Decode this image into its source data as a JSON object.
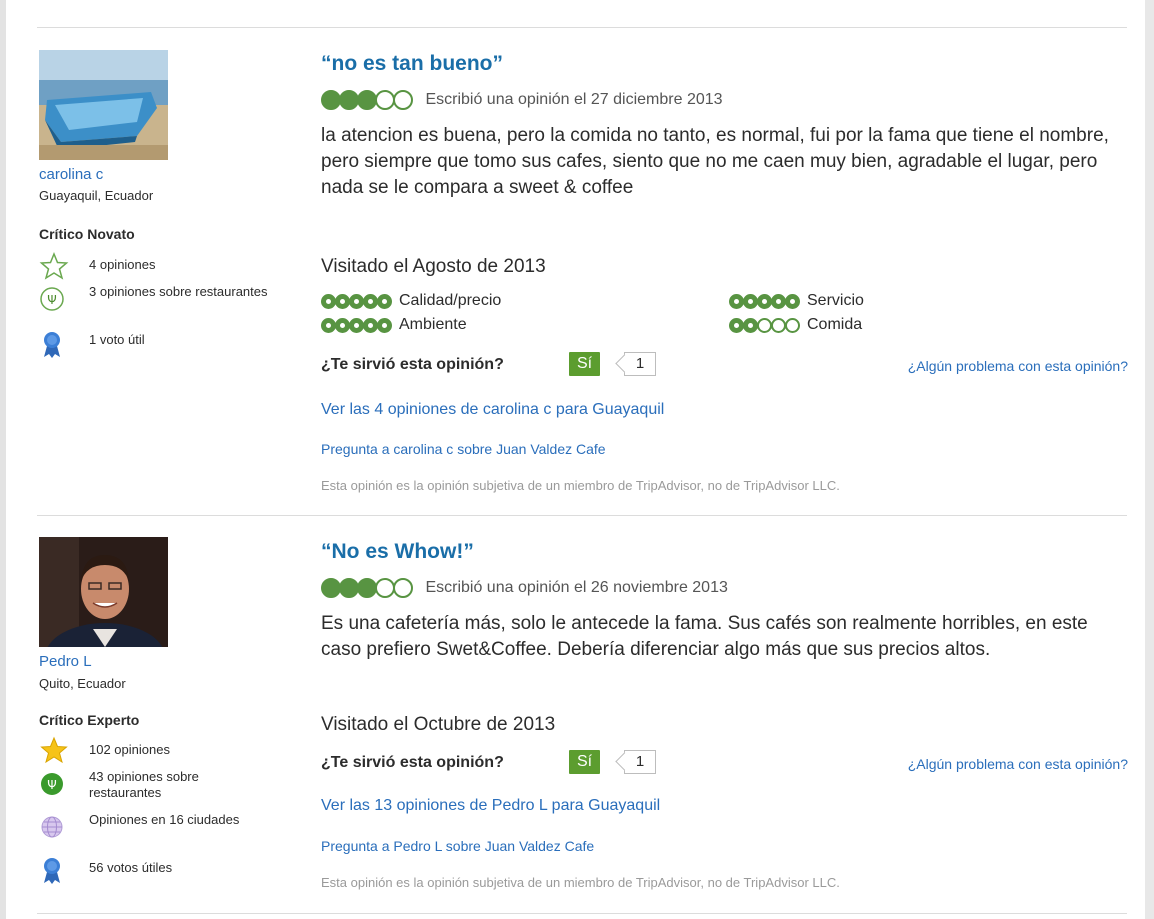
{
  "colors": {
    "link": "#2a6ebb",
    "title": "#1a6ea8",
    "bubble": "#589442",
    "helpful_button": "#5c9d2f",
    "disclaimer": "#9a9a9a"
  },
  "reviews": [
    {
      "user": {
        "name": "carolina c",
        "location": "Guayaquil, Ecuador",
        "level": "Crítico Novato"
      },
      "badges": [
        {
          "icon": "star-outline-icon",
          "text": "4 opiniones"
        },
        {
          "icon": "restaurant-fork-icon",
          "text": "3 opiniones sobre restaurantes"
        },
        {
          "icon": "ribbon-icon",
          "text": "1 voto útil"
        }
      ],
      "title": "“no es tan bueno”",
      "rating": 3,
      "date": "Escribió una opinión el 27 diciembre 2013",
      "body": "la atencion es buena, pero la comida no tanto, es normal, fui por la fama que tiene el nombre, pero siempre que tomo sus cafes, siento que no me caen muy bien, agradable el lugar, pero nada se le compara a sweet & coffee",
      "visited": "Visitado el Agosto de 2013",
      "subratings": [
        {
          "label": "Calidad/precio",
          "value": 5
        },
        {
          "label": "Servicio",
          "value": 5
        },
        {
          "label": "Ambiente",
          "value": 5
        },
        {
          "label": "Comida",
          "value": 2
        }
      ],
      "helpful_question": "¿Te sirvió esta opinión?",
      "helpful_button": "Sí",
      "helpful_count": "1",
      "problem_link": "¿Algún problema con esta opinión?",
      "all_reviews_link": "Ver las 4 opiniones de carolina c para Guayaquil",
      "ask_link": "Pregunta a carolina c sobre Juan Valdez Cafe",
      "disclaimer": "Esta opinión es la opinión subjetiva de un miembro de TripAdvisor, no de TripAdvisor LLC."
    },
    {
      "user": {
        "name": "Pedro L",
        "location": "Quito, Ecuador",
        "level": "Crítico Experto"
      },
      "badges": [
        {
          "icon": "star-filled-icon",
          "text": "102 opiniones"
        },
        {
          "icon": "restaurant-fork-icon",
          "text": "43 opiniones sobre restaurantes"
        },
        {
          "icon": "globe-icon",
          "text": "Opiniones en 16 ciudades"
        },
        {
          "icon": "ribbon-icon",
          "text": "56 votos útiles"
        }
      ],
      "title": "“No es Whow!”",
      "rating": 3,
      "date": "Escribió una opinión el 26 noviembre 2013",
      "body": "Es una cafetería más, solo le antecede la fama. Sus cafés son realmente horribles, en este caso prefiero Swet&Coffee. Debería diferenciar algo más que sus precios altos.",
      "visited": "Visitado el Octubre de 2013",
      "helpful_question": "¿Te sirvió esta opinión?",
      "helpful_button": "Sí",
      "helpful_count": "1",
      "problem_link": "¿Algún problema con esta opinión?",
      "all_reviews_link": "Ver las 13 opiniones de Pedro L para Guayaquil",
      "ask_link": "Pregunta a Pedro L sobre Juan Valdez Cafe",
      "disclaimer": "Esta opinión es la opinión subjetiva de un miembro de TripAdvisor, no de TripAdvisor LLC."
    }
  ]
}
